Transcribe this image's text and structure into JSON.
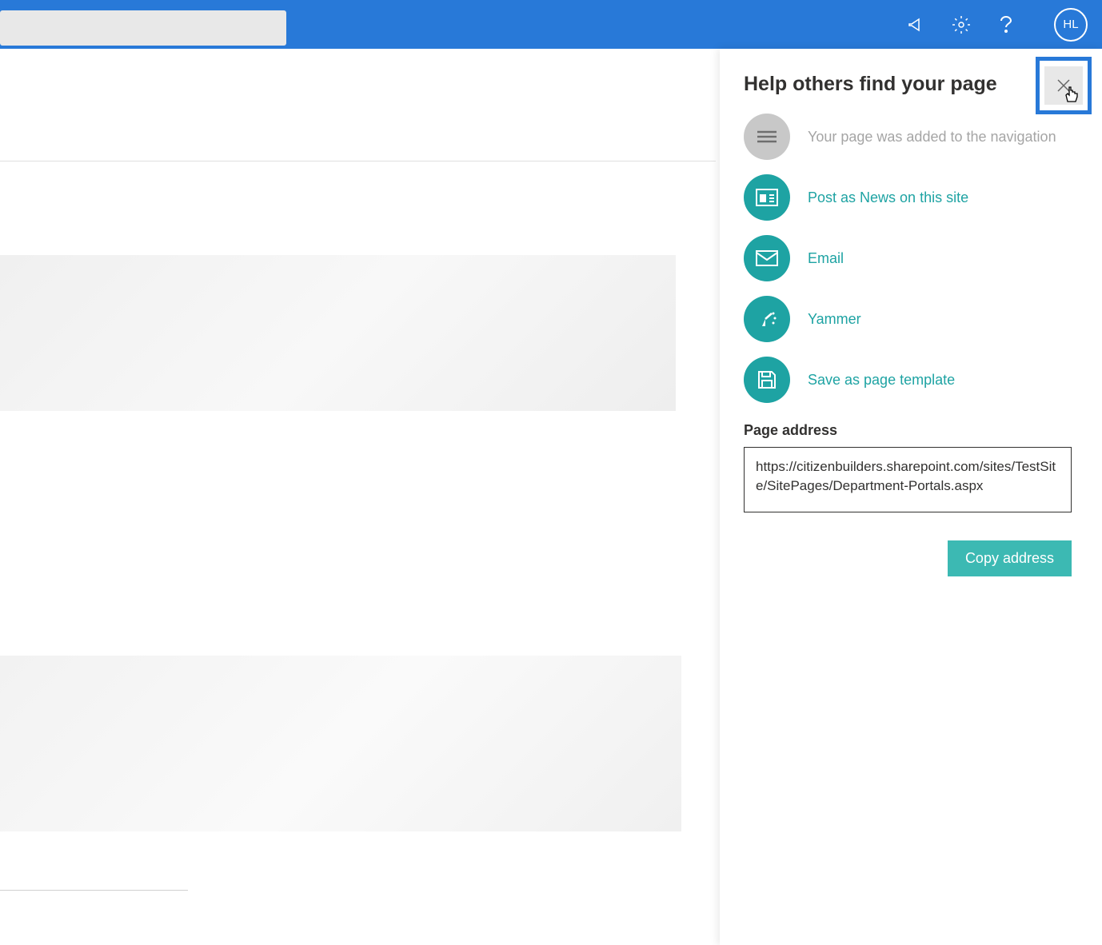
{
  "header": {
    "avatar_initials": "HL"
  },
  "panel": {
    "title": "Help others find your page",
    "actions": {
      "navigation": {
        "label": "Your page was added to the navigation"
      },
      "post_news": {
        "label": "Post as News on this site"
      },
      "email": {
        "label": "Email"
      },
      "yammer": {
        "label": "Yammer"
      },
      "save_template": {
        "label": "Save as page template"
      }
    },
    "page_address": {
      "label": "Page address",
      "value": "https://citizenbuilders.sharepoint.com/sites/TestSite/SitePages/Department-Portals.aspx"
    },
    "copy_button": {
      "label": "Copy address"
    }
  }
}
